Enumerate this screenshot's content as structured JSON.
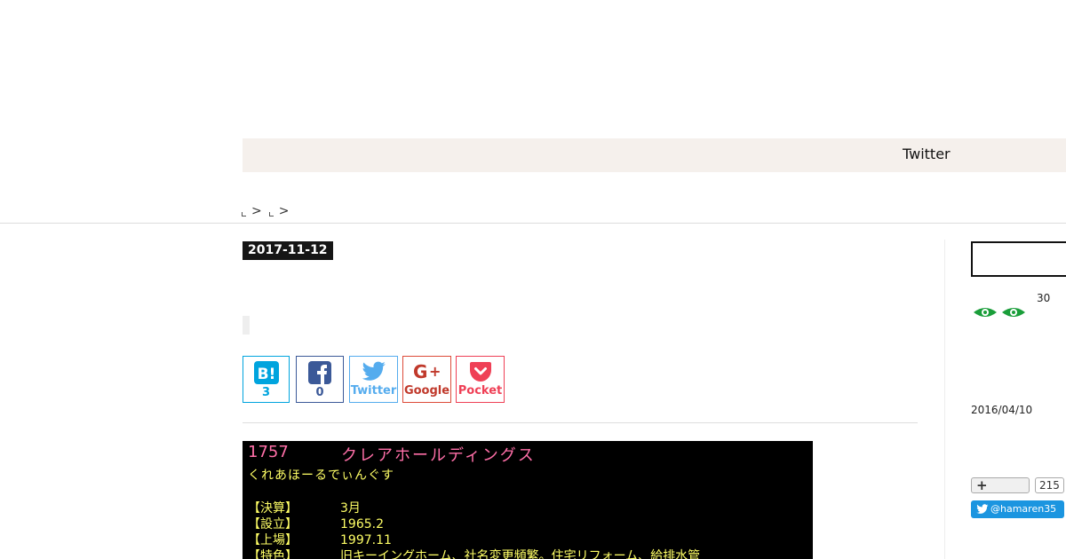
{
  "nav": {
    "twitter_label": "Twitter"
  },
  "breadcrumb": {
    "separator": ">"
  },
  "entry": {
    "date": "2017-11-12"
  },
  "share": {
    "hatena": {
      "count": "3"
    },
    "facebook": {
      "count": "0"
    },
    "twitter": {
      "label": "Twitter"
    },
    "google": {
      "label": "Google"
    },
    "pocket": {
      "label": "Pocket"
    }
  },
  "terminal": {
    "code": "1757",
    "name": "クレアホールディングス",
    "reading": "くれあほーるでぃんぐす",
    "rows": [
      {
        "key": "【決算】",
        "value": "3月"
      },
      {
        "key": "【設立】",
        "value": "1965.2"
      },
      {
        "key": "【上場】",
        "value": "1997.11"
      },
      {
        "key": "【特色】",
        "value": "旧キーイングホーム、社名変更頻繁。住宅リフォーム、給排水管"
      }
    ]
  },
  "sidebar": {
    "count": "30",
    "date": "2016/04/10",
    "follow_count": "215",
    "twitter_handle": "@hamaren35"
  },
  "colors": {
    "terminal_pink": "#ff6fa8",
    "terminal_yellow": "#ffff66",
    "eye_green": "#1a9e3a",
    "twitter_blue": "#1b95e0"
  }
}
